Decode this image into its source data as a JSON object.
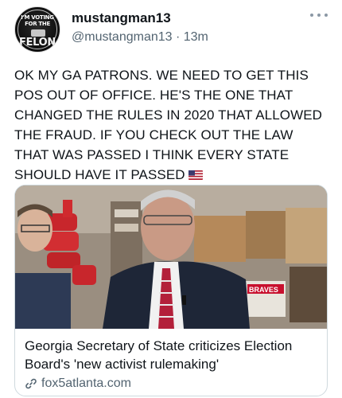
{
  "post": {
    "author_name": "mustangman13",
    "handle": "@mustangman13",
    "separator": " · ",
    "timestamp": "13m",
    "text": "OK MY GA PATRONS. WE NEED TO GET THIS POS OUT OF OFFICE. HE'S THE ONE THAT CHANGED THE RULES IN 2020 THAT ALLOWED THE FRAUD. IF YOU CHECK OUT THE LAW THAT WAS PASSED I THINK EVERY STATE SHOULD HAVE IT PASSED",
    "emoji": "us-flag-emoji"
  },
  "avatar": {
    "line1": "I'M VOTING",
    "line2": "FOR THE",
    "line3": "FELON"
  },
  "link_card": {
    "title": "Georgia Secretary of State criticizes Election Board's 'new activist rulemaking'",
    "domain": "fox5atlanta.com",
    "image_sign": "BRAVES"
  },
  "icons": {
    "more": "more-dots-icon",
    "link": "link-icon"
  },
  "colors": {
    "text": "#0f1419",
    "secondary": "#536471",
    "border": "#cfd9de"
  }
}
